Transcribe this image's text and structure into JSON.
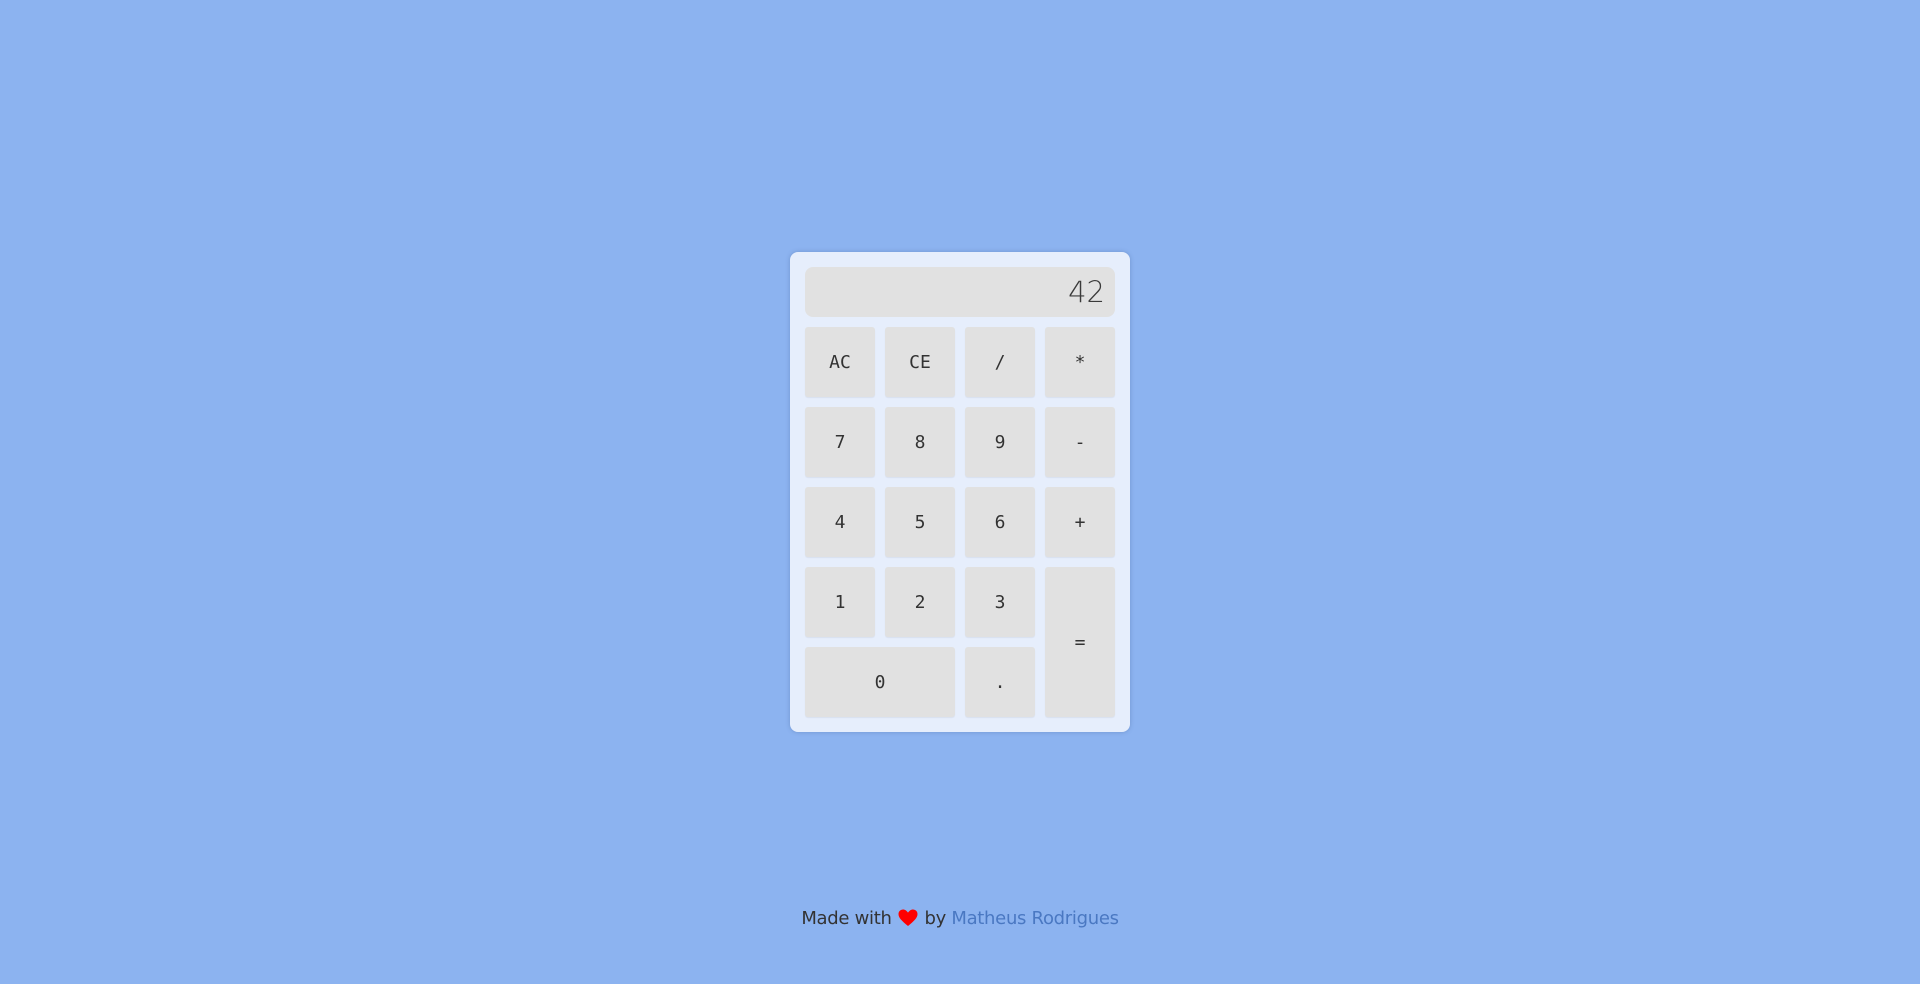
{
  "calculator": {
    "display_value": "42",
    "keys": {
      "ac": "AC",
      "ce": "CE",
      "divide": "/",
      "multiply": "*",
      "seven": "7",
      "eight": "8",
      "nine": "9",
      "minus": "-",
      "four": "4",
      "five": "5",
      "six": "6",
      "plus": "+",
      "one": "1",
      "two": "2",
      "three": "3",
      "equals": "=",
      "zero": "0",
      "decimal": "."
    }
  },
  "footer": {
    "made_with": "Made with",
    "heart_icon": "heart-icon",
    "by": "by",
    "author_link": "Matheus Rodrigues"
  },
  "colors": {
    "background": "#8cb3f0",
    "calculator_body": "#e6eefc",
    "key": "#e1e1e1",
    "heart": "#ff0000",
    "link": "#4a78c2"
  }
}
